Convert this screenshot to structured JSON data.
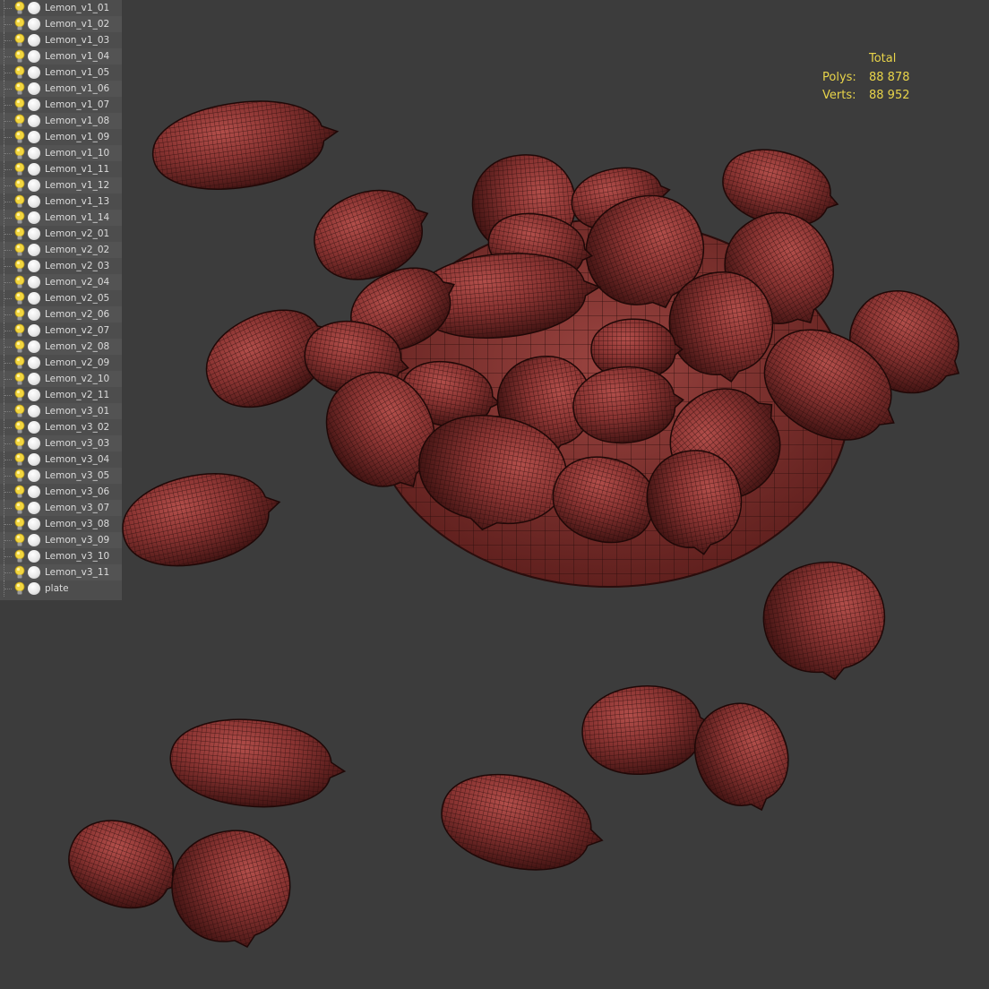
{
  "scene_explorer": {
    "layers": [
      "Lemon_v1_01",
      "Lemon_v1_02",
      "Lemon_v1_03",
      "Lemon_v1_04",
      "Lemon_v1_05",
      "Lemon_v1_06",
      "Lemon_v1_07",
      "Lemon_v1_08",
      "Lemon_v1_09",
      "Lemon_v1_10",
      "Lemon_v1_11",
      "Lemon_v1_12",
      "Lemon_v1_13",
      "Lemon_v1_14",
      "Lemon_v2_01",
      "Lemon_v2_02",
      "Lemon_v2_03",
      "Lemon_v2_04",
      "Lemon_v2_05",
      "Lemon_v2_06",
      "Lemon_v2_07",
      "Lemon_v2_08",
      "Lemon_v2_09",
      "Lemon_v2_10",
      "Lemon_v2_11",
      "Lemon_v3_01",
      "Lemon_v3_02",
      "Lemon_v3_03",
      "Lemon_v3_04",
      "Lemon_v3_05",
      "Lemon_v3_06",
      "Lemon_v3_07",
      "Lemon_v3_08",
      "Lemon_v3_09",
      "Lemon_v3_10",
      "Lemon_v3_11",
      "plate"
    ],
    "icons": {
      "visibility": "lightbulb-icon",
      "render": "sphere-icon"
    }
  },
  "statistics": {
    "header": "Total",
    "polys_label": "Polys:",
    "polys_value": "88 878",
    "verts_label": "Verts:",
    "verts_value": "88 952"
  },
  "colors": {
    "viewport_bg": "#3c3c3c",
    "panel_bg": "#4d4d4d",
    "mesh_fill": "#8a3432",
    "wire": "#2a0d0c",
    "stats_text": "#e8d44a"
  }
}
